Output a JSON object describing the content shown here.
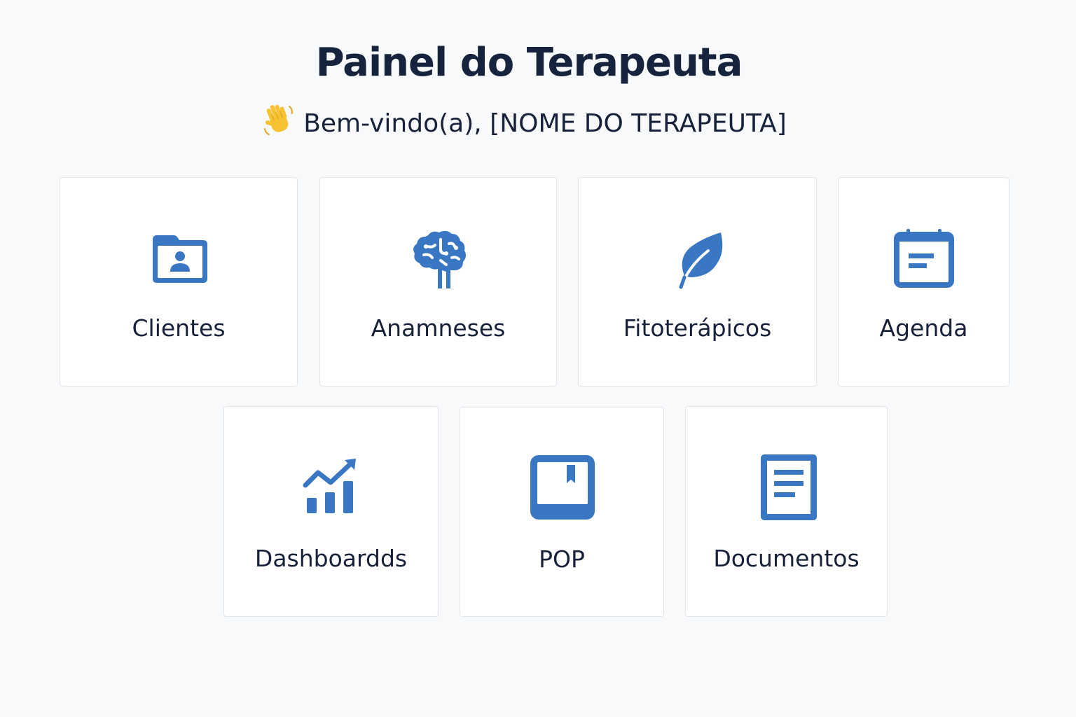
{
  "header": {
    "title": "Painel do Terapeuta",
    "greeting": "Bem-vindo(a), [NOME DO TERAPEUTA]",
    "greeting_icon": "waving-hand-emoji"
  },
  "accent_color": "#3a77c3",
  "cards": [
    {
      "label": "Clientes",
      "icon": "client-folder-icon"
    },
    {
      "label": "Anamneses",
      "icon": "brain-icon"
    },
    {
      "label": "Fitoterápicos",
      "icon": "leaf-icon"
    },
    {
      "label": "Agenda",
      "icon": "calendar-icon"
    },
    {
      "label": "Dashboardds",
      "icon": "chart-trend-icon"
    },
    {
      "label": "POP",
      "icon": "book-bookmark-icon"
    },
    {
      "label": "Documentos",
      "icon": "document-icon"
    }
  ]
}
